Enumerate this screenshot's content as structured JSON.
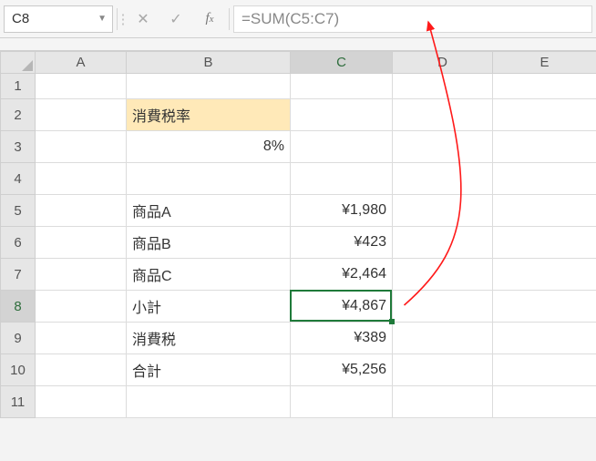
{
  "nameBox": {
    "value": "C8"
  },
  "formulaBar": {
    "value": "=SUM(C5:C7)"
  },
  "columns": {
    "A": "A",
    "B": "B",
    "C": "C",
    "D": "D",
    "E": "E"
  },
  "rows": {
    "r1": "1",
    "r2": "2",
    "r3": "3",
    "r4": "4",
    "r5": "5",
    "r6": "6",
    "r7": "7",
    "r8": "8",
    "r9": "9",
    "r10": "10",
    "r11": "11"
  },
  "cells": {
    "B2": "消費税率",
    "B3": "8%",
    "B5": "商品A",
    "B6": "商品B",
    "B7": "商品C",
    "B8": "小計",
    "B9": "消費税",
    "B10": "合計",
    "C5": "¥1,980",
    "C6": "¥423",
    "C7": "¥2,464",
    "C8": "¥4,867",
    "C9": "¥389",
    "C10": "¥5,256"
  },
  "selection": {
    "cell": "C8"
  }
}
